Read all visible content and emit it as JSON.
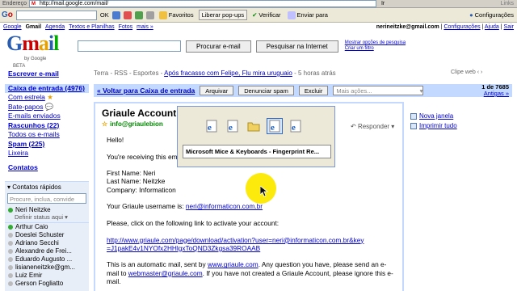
{
  "browser": {
    "address_label": "Endereço",
    "url": "http://mail.google.com/mail/",
    "go_label": "Ir",
    "links_label": "Links"
  },
  "toolbar": {
    "ok_label": "OK",
    "favorites_label": "Favoritos",
    "popups_label": "Liberar pop-ups",
    "verify_label": "Verificar",
    "send_label": "Enviar para",
    "settings_label": "Configurações"
  },
  "gmail_nav": {
    "links": [
      "Google",
      "Gmail",
      "Agenda",
      "Textos e Planilhas",
      "Fotos",
      "mais »"
    ],
    "user_email": "nerineitzke@gmail.com",
    "user_links": [
      "Configurações",
      "Ajuda",
      "Sair"
    ]
  },
  "logo": {
    "by": "by Google",
    "beta": "BETA"
  },
  "search": {
    "search_mail_btn": "Procurar e-mail",
    "search_web_btn": "Pesquisar na Internet",
    "options_link": "Mostrar opções de pesquisa",
    "filter_link": "Criar um filtro"
  },
  "leftnav": {
    "compose": "Escrever e-mail",
    "inbox": "Caixa de entrada (4976)",
    "items": [
      "Com estrela",
      "Bate-papos",
      "E-mails enviados",
      "Rascunhos (22)",
      "Todos os e-mails",
      "Spam (225)",
      "Lixeira"
    ],
    "contacts": "Contatos"
  },
  "quick_contacts": {
    "header": "Contatos rápidos",
    "search_placeholder": "Procure, inclua, convide",
    "me": "Neri Neitzke",
    "status": "Definir status aqui",
    "contacts": [
      {
        "name": "Arthur Caio",
        "status": "green"
      },
      {
        "name": "Doeslei Schuster",
        "status": "gray"
      },
      {
        "name": "Adriano Secchi",
        "status": "gray"
      },
      {
        "name": "Alexandre de Frei...",
        "status": "gray"
      },
      {
        "name": "Eduardo Augusto ...",
        "status": "gray"
      },
      {
        "name": "lisianeneitzke@gm...",
        "status": "gray"
      },
      {
        "name": "Luiz Emir",
        "status": "gray"
      },
      {
        "name": "Gerson Fogliatto",
        "status": "gray"
      }
    ]
  },
  "rss": {
    "prefix": "Terra - RSS - Esportes - ",
    "headline": "Após fracasso com Felipe, Flu mira uruguaio",
    "time": " - 5 horas atrás",
    "clip": "Clipe web"
  },
  "actions": {
    "back": "« Voltar para Caixa de entrada",
    "archive": "Arquivar",
    "spam": "Denunciar spam",
    "delete": "Excluir",
    "more": "Mais ações...",
    "count": "1 de 7685",
    "older": "Antigas »"
  },
  "message": {
    "subject": "Griaule Account A",
    "from": "info@griaulebion",
    "reply": "Responder",
    "greeting": "Hello!",
    "line1": "You're receiving this em",
    "first_name": "First Name: Neri",
    "last_name": "Last Name: Neitzke",
    "company": "Company: Informaticon",
    "username_text": "Your Griaule username is: ",
    "username_link": "neri@informaticon.com.br",
    "click_text": "Please, click on the following link to activate your account:",
    "activation_link1": "http://www.griaule.com/page/download/activation?user=neri@informaticon.com.br&key",
    "activation_link2": "=J1pakE4v1NYOfx2HHlgxToQND3Zkgsa39ROAAB",
    "auto1a": "This is an automatic mail, sent by ",
    "auto1b": "www.griaule.com",
    "auto1c": ". Any question you have, please send an e-",
    "auto2a": "mail to ",
    "auto2b": "webmaster@griaule.com",
    "auto2c": ". If you have not created a Griaule Account, please ignore this e-",
    "auto3": "mail."
  },
  "side_actions": {
    "new_window": "Nova janela",
    "print_all": "Imprimir tudo"
  },
  "switcher": {
    "selected_title": "Microsoft Mice & Keyboards - Fingerprint Re..."
  }
}
